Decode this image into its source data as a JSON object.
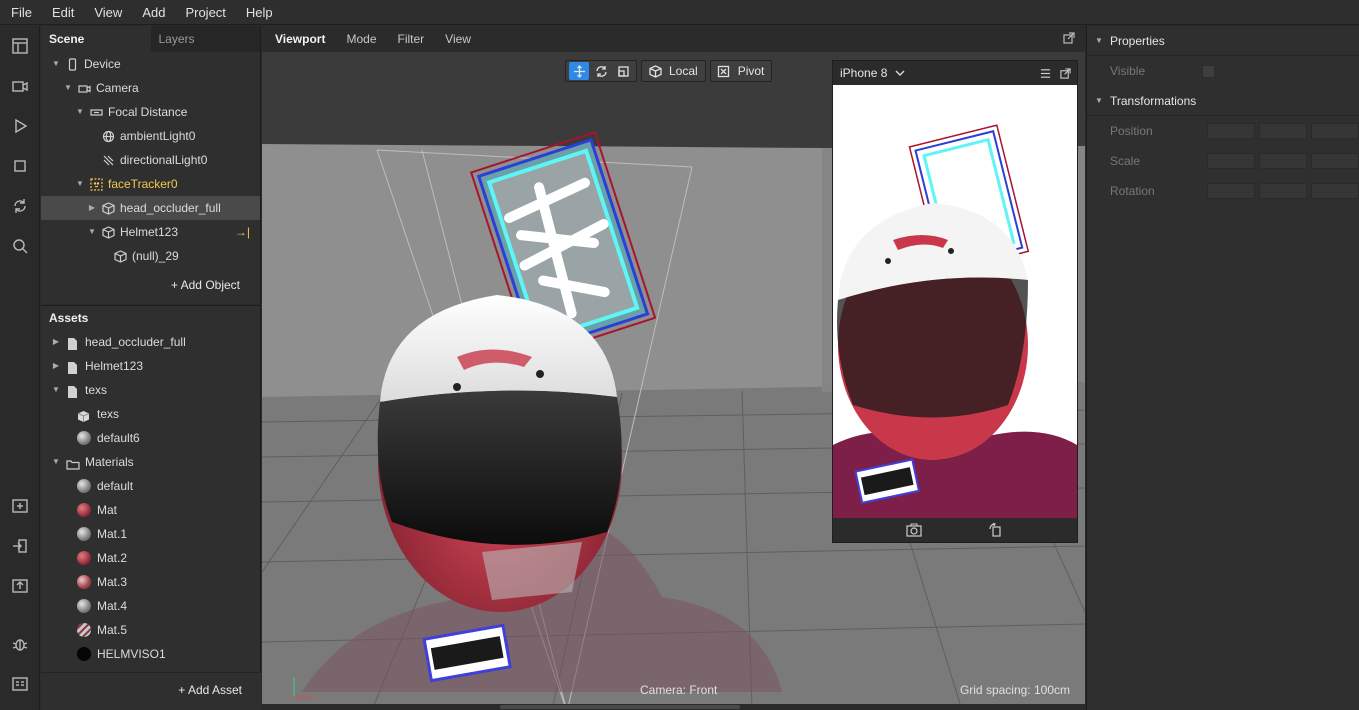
{
  "menu": [
    "File",
    "Edit",
    "View",
    "Add",
    "Project",
    "Help"
  ],
  "toolstrip": [
    "layout-icon",
    "video-icon",
    "play-icon",
    "stop-icon",
    "sync-icon",
    "search-icon",
    "add-file-icon",
    "import-icon",
    "export-icon",
    "bug-icon",
    "console-icon"
  ],
  "scene": {
    "tabs": [
      "Scene",
      "Layers"
    ],
    "tree": [
      {
        "label": "Device",
        "icon": "phone-icon",
        "depth": 0,
        "expanded": true
      },
      {
        "label": "Camera",
        "icon": "camera-icon",
        "depth": 1,
        "expanded": true
      },
      {
        "label": "Focal Distance",
        "icon": "focal-distance-icon",
        "depth": 2,
        "expanded": true
      },
      {
        "label": "ambientLight0",
        "icon": "globe-icon",
        "depth": 3,
        "expanded": null
      },
      {
        "label": "directionalLight0",
        "icon": "directional-light-icon",
        "depth": 3,
        "expanded": null
      },
      {
        "label": "faceTracker0",
        "icon": "face-tracker-icon",
        "depth": 2,
        "expanded": true,
        "highlight": true
      },
      {
        "label": "head_occluder_full",
        "icon": "cube-icon",
        "depth": 3,
        "expanded": false,
        "selected": true
      },
      {
        "label": "Helmet123",
        "icon": "cube-icon",
        "depth": 3,
        "expanded": true,
        "badge": "→|"
      },
      {
        "label": "(null)_29",
        "icon": "cube-icon",
        "depth": 4,
        "expanded": null
      }
    ],
    "add_object": "+ Add Object"
  },
  "assets": {
    "title": "Assets",
    "items": [
      {
        "label": "head_occluder_full",
        "icon": "file",
        "arrow": "collapsed",
        "indent": 0
      },
      {
        "label": "Helmet123",
        "icon": "file",
        "arrow": "collapsed",
        "indent": 0
      },
      {
        "label": "texs",
        "icon": "file",
        "arrow": "expanded",
        "indent": 0
      },
      {
        "label": "texs",
        "icon": "cube",
        "arrow": "none",
        "indent": 1
      },
      {
        "label": "default6",
        "icon": "sphere-grey",
        "arrow": "none",
        "indent": 1
      },
      {
        "label": "Materials",
        "icon": "folder",
        "arrow": "expanded",
        "indent": 0
      },
      {
        "label": "default",
        "icon": "sphere-grey",
        "arrow": "none",
        "indent": 1
      },
      {
        "label": "Mat",
        "icon": "sphere-red",
        "arrow": "none",
        "indent": 1
      },
      {
        "label": "Mat.1",
        "icon": "sphere-grey",
        "arrow": "none",
        "indent": 1
      },
      {
        "label": "Mat.2",
        "icon": "sphere-red",
        "arrow": "none",
        "indent": 1
      },
      {
        "label": "Mat.3",
        "icon": "sphere-mixed",
        "arrow": "none",
        "indent": 1
      },
      {
        "label": "Mat.4",
        "icon": "sphere-grey",
        "arrow": "none",
        "indent": 1
      },
      {
        "label": "Mat.5",
        "icon": "sphere-striped",
        "arrow": "none",
        "indent": 1
      },
      {
        "label": "HELMVISO1",
        "icon": "sphere-black",
        "arrow": "none",
        "indent": 1
      }
    ],
    "add_asset": "+ Add Asset"
  },
  "viewport": {
    "tabs": [
      "Viewport",
      "Mode",
      "Filter",
      "View"
    ],
    "toolbar": {
      "local": "Local",
      "pivot": "Pivot"
    },
    "camera_label": "Camera: Front",
    "grid_label": "Grid spacing: 100cm",
    "accent": "#2e8ae6"
  },
  "preview": {
    "device": "iPhone 8"
  },
  "properties": {
    "sections": [
      {
        "title": "Properties",
        "rows": [
          "Visible"
        ]
      },
      {
        "title": "Transformations",
        "rows": [
          "Position",
          "Scale",
          "Rotation"
        ]
      }
    ]
  },
  "colors": {
    "face_tracker_highlight": "#f3c74f",
    "helmet_red": "#c8384a",
    "shirt_magenta": "#7e1f4a"
  }
}
